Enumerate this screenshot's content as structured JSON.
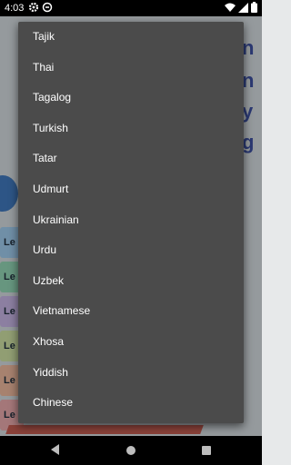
{
  "status_bar": {
    "time": "4:03",
    "icons_left": [
      "gear-icon",
      "sync-icon"
    ],
    "icons_right": [
      "wifi-icon",
      "cell-signal-icon",
      "battery-icon"
    ]
  },
  "menu": {
    "items": [
      {
        "label": "Tajik"
      },
      {
        "label": "Thai"
      },
      {
        "label": "Tagalog"
      },
      {
        "label": "Turkish"
      },
      {
        "label": "Tatar"
      },
      {
        "label": "Udmurt"
      },
      {
        "label": "Ukrainian"
      },
      {
        "label": "Urdu"
      },
      {
        "label": "Uzbek"
      },
      {
        "label": "Vietnamese"
      },
      {
        "label": "Xhosa"
      },
      {
        "label": "Yiddish"
      },
      {
        "label": "Chinese"
      }
    ]
  },
  "background": {
    "tile_label": "Le"
  },
  "colors": {
    "menu_bg": "#4b4b4b",
    "menu_text": "#ffffff",
    "status_bar": "#000000"
  },
  "nav_bar": {
    "buttons": [
      "back-icon",
      "home-icon",
      "recents-icon"
    ]
  }
}
